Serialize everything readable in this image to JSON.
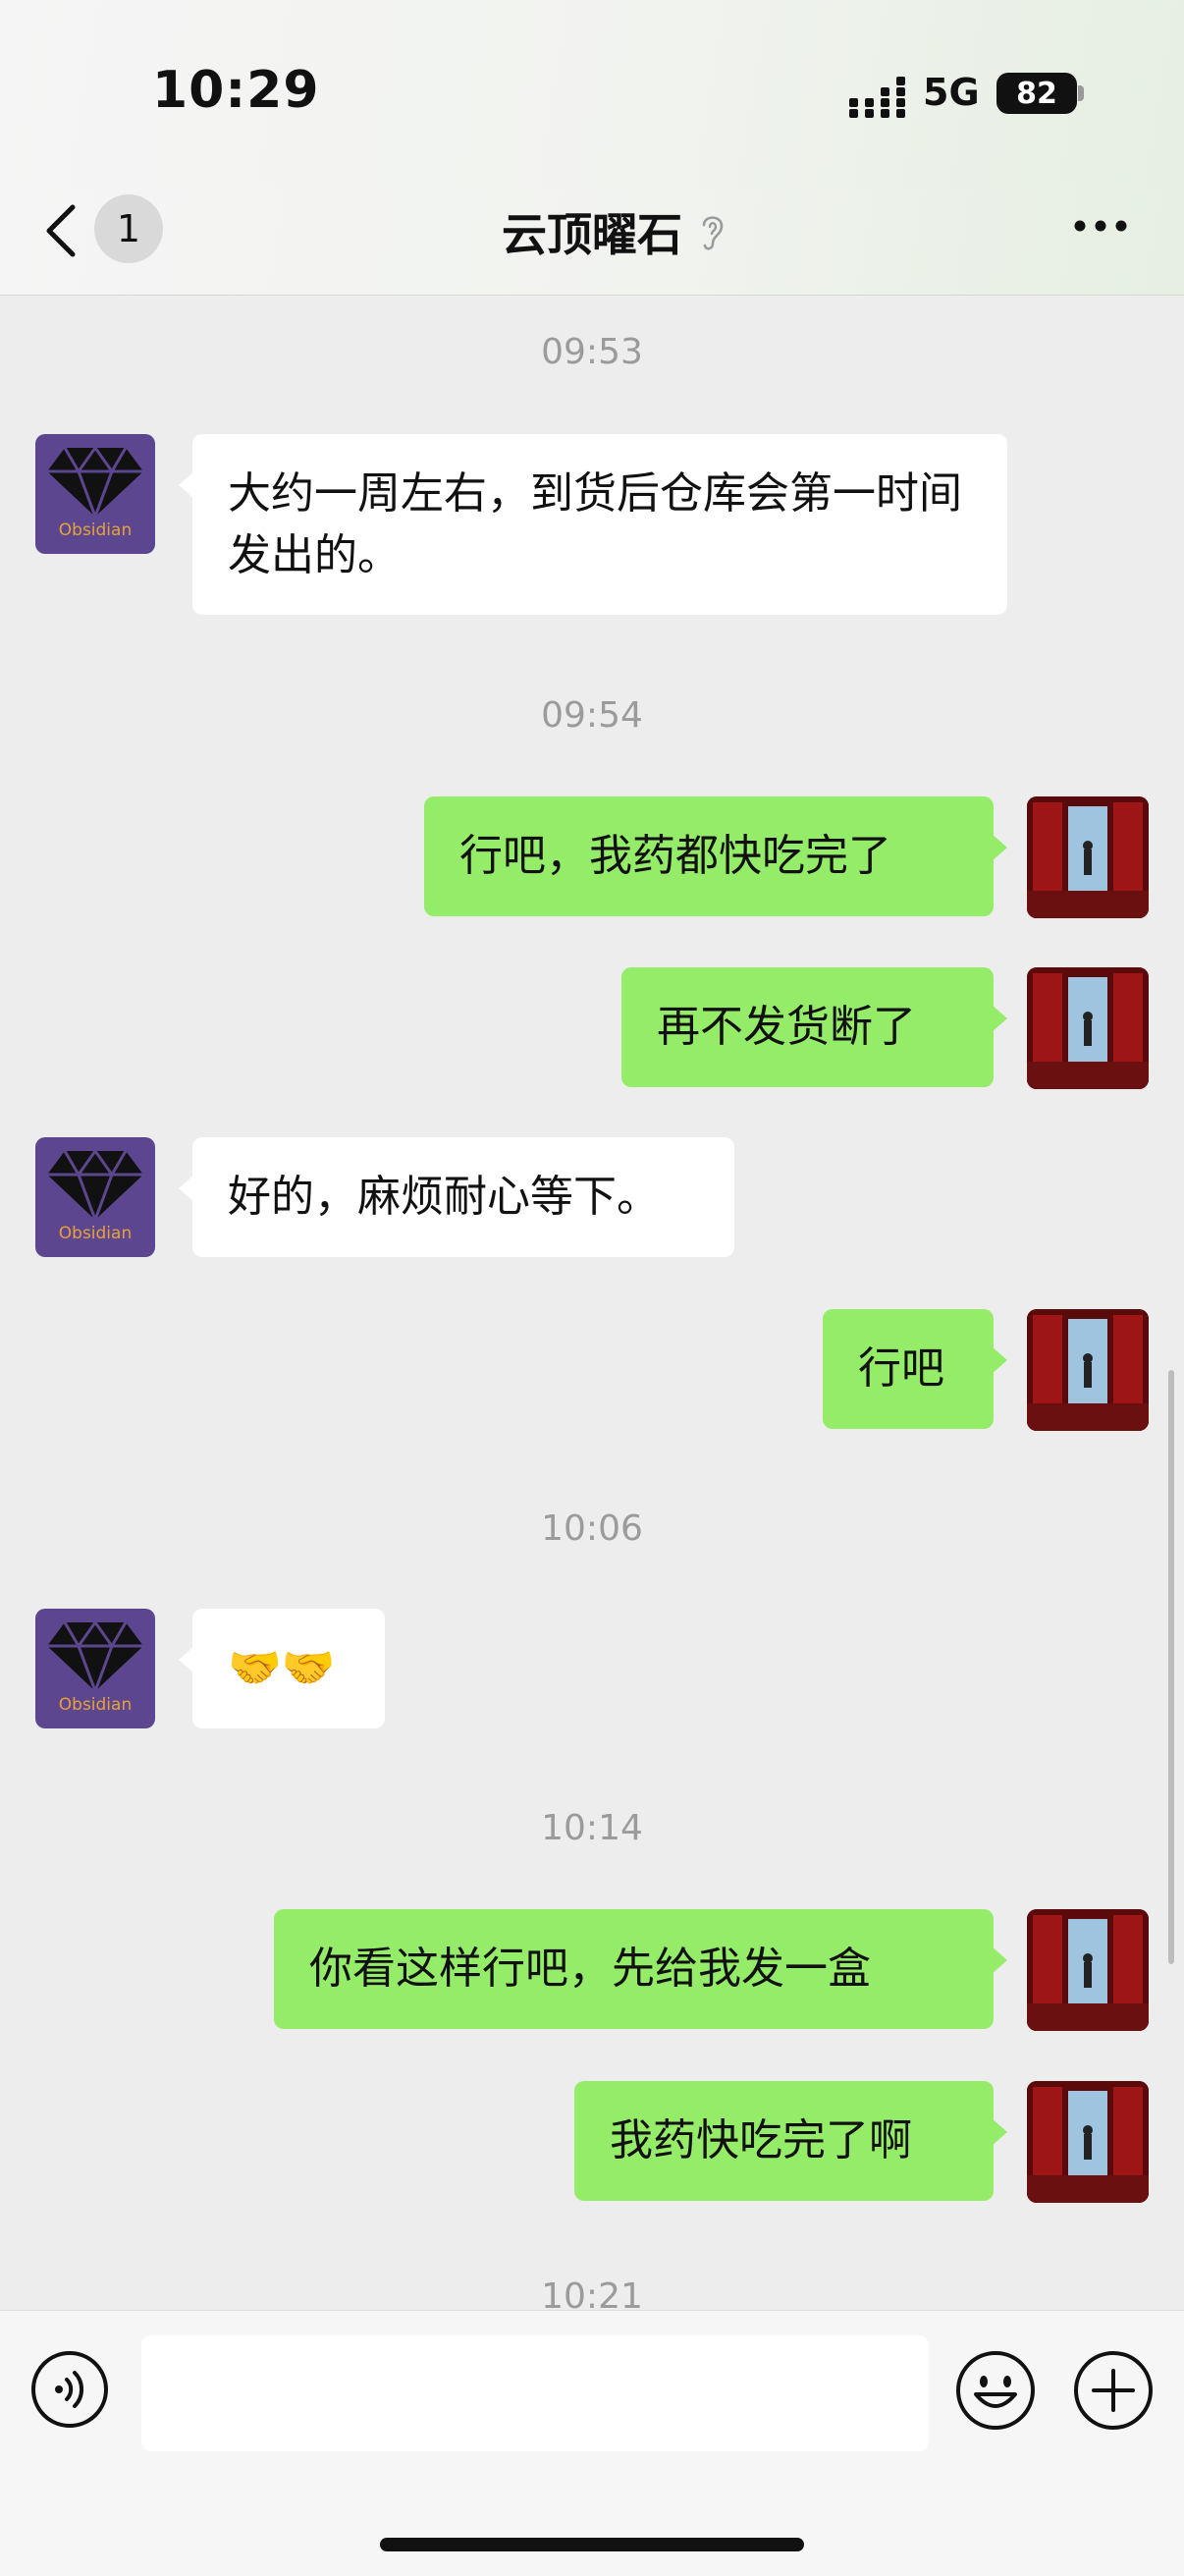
{
  "status": {
    "time": "10:29",
    "network": "5G",
    "battery": "82"
  },
  "nav": {
    "unread_count": "1",
    "title": "云顶曜石"
  },
  "contact_avatar_text": "Obsidian",
  "messages": [
    {
      "type": "time",
      "text": "09:53"
    },
    {
      "type": "bubble",
      "side": "left",
      "text": "大约一周左右，到货后仓库会第一时间发出的。"
    },
    {
      "type": "time",
      "text": "09:54"
    },
    {
      "type": "bubble",
      "side": "right",
      "text": "行吧，我药都快吃完了"
    },
    {
      "type": "bubble",
      "side": "right",
      "text": "再不发货断了"
    },
    {
      "type": "bubble",
      "side": "left",
      "text": "好的，麻烦耐心等下。"
    },
    {
      "type": "bubble",
      "side": "right",
      "text": "行吧"
    },
    {
      "type": "time",
      "text": "10:06"
    },
    {
      "type": "bubble",
      "side": "left",
      "text": "🤝🤝"
    },
    {
      "type": "time",
      "text": "10:14"
    },
    {
      "type": "bubble",
      "side": "right",
      "text": "你看这样行吧，先给我发一盒"
    },
    {
      "type": "bubble",
      "side": "right",
      "text": "我药快吃完了啊"
    },
    {
      "type": "time",
      "text": "10:21"
    }
  ],
  "input": {
    "value": ""
  },
  "colors": {
    "sent_bubble": "#95ec69",
    "received_bubble": "#ffffff",
    "chat_background": "#ededed",
    "avatar_purple": "#5c4690",
    "avatar_label": "#e7a13b"
  }
}
